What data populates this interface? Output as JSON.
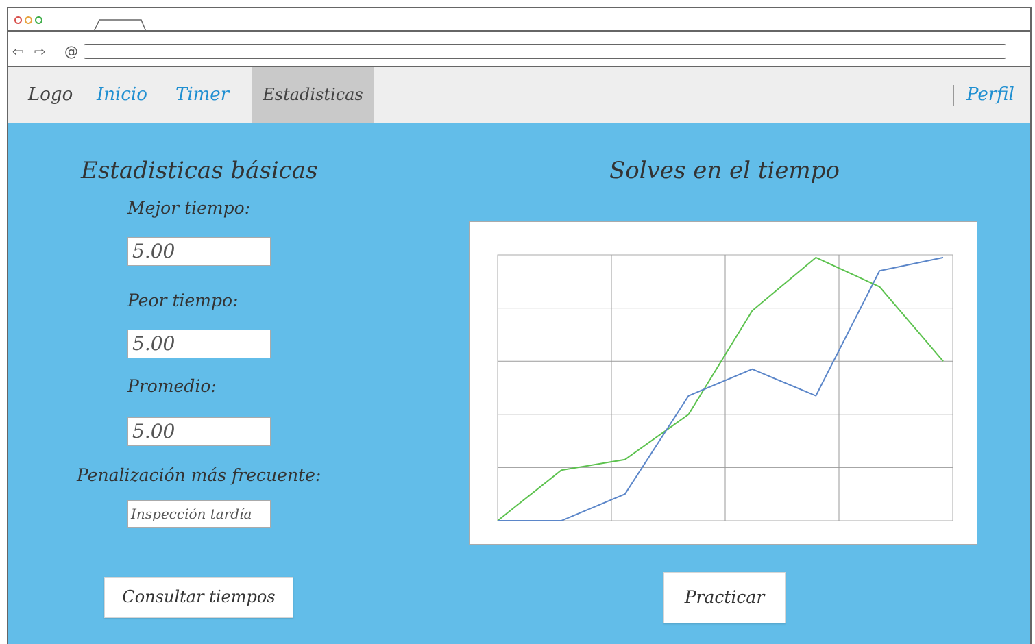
{
  "browser": {
    "back_icon": "back-arrow-icon",
    "forward_icon": "forward-arrow-icon",
    "url_icon": "at-icon",
    "url_value": ""
  },
  "navbar": {
    "logo": "Logo",
    "items": [
      {
        "label": "Inicio"
      },
      {
        "label": "Timer"
      },
      {
        "label": "Estadisticas",
        "active": true
      }
    ],
    "profile": "Perfil"
  },
  "stats": {
    "title": "Estadisticas básicas",
    "best_label": "Mejor tiempo:",
    "best_value": "5.00",
    "worst_label": "Peor tiempo:",
    "worst_value": "5.00",
    "avg_label": "Promedio:",
    "avg_value": "5.00",
    "penalty_label": "Penalización más frecuente:",
    "penalty_value": "Inspección tardía",
    "consult_button": "Consultar tiempos"
  },
  "chart_section": {
    "title": "Solves en el tiempo",
    "practice_button": "Practicar"
  },
  "colors": {
    "background": "#62bde9",
    "link": "#1f8fd1",
    "series_green": "#5cc24e",
    "series_blue": "#5b86c9"
  },
  "chart_data": {
    "type": "line",
    "x": [
      1,
      2,
      3,
      4,
      5,
      6,
      7,
      8
    ],
    "xlim": [
      1,
      8.15
    ],
    "ylim": [
      0,
      5
    ],
    "grid": true,
    "series": [
      {
        "values": [
          0,
          0.95,
          1.15,
          2.0,
          3.95,
          4.95,
          4.4,
          3.0
        ],
        "color": "#5cc24e"
      },
      {
        "values": [
          0,
          0,
          0.5,
          2.35,
          2.85,
          2.35,
          4.7,
          4.95
        ],
        "color": "#5b86c9"
      }
    ]
  }
}
